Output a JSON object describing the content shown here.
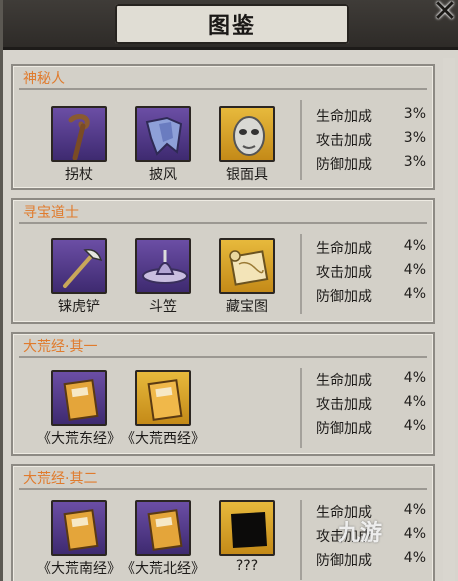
{
  "window": {
    "title": "图鉴",
    "close_label": "✕"
  },
  "sets": [
    {
      "name": "神秘人",
      "items": [
        {
          "label": "拐杖",
          "icon": "cane-icon",
          "rarity": "purple"
        },
        {
          "label": "披风",
          "icon": "cloak-icon",
          "rarity": "purple"
        },
        {
          "label": "银面具",
          "icon": "silver-mask-icon",
          "rarity": "gold"
        }
      ],
      "stats": [
        {
          "name": "生命加成",
          "value": "3%"
        },
        {
          "name": "攻击加成",
          "value": "3%"
        },
        {
          "name": "防御加成",
          "value": "3%"
        }
      ]
    },
    {
      "name": "寻宝道士",
      "items": [
        {
          "label": "铼虎铲",
          "icon": "shovel-icon",
          "rarity": "purple"
        },
        {
          "label": "斗笠",
          "icon": "straw-hat-icon",
          "rarity": "purple"
        },
        {
          "label": "藏宝图",
          "icon": "treasure-map-icon",
          "rarity": "gold"
        }
      ],
      "stats": [
        {
          "name": "生命加成",
          "value": "4%"
        },
        {
          "name": "攻击加成",
          "value": "4%"
        },
        {
          "name": "防御加成",
          "value": "4%"
        }
      ]
    },
    {
      "name": "大荒经·其一",
      "items": [
        {
          "label": "《大荒东经》",
          "icon": "scripture-book-icon",
          "rarity": "purple"
        },
        {
          "label": "《大荒西经》",
          "icon": "scripture-book-icon",
          "rarity": "gold"
        }
      ],
      "stats": [
        {
          "name": "生命加成",
          "value": "4%"
        },
        {
          "name": "攻击加成",
          "value": "4%"
        },
        {
          "name": "防御加成",
          "value": "4%"
        }
      ]
    },
    {
      "name": "大荒经·其二",
      "items": [
        {
          "label": "《大荒南经》",
          "icon": "scripture-book-icon",
          "rarity": "purple"
        },
        {
          "label": "《大荒北经》",
          "icon": "scripture-book-icon",
          "rarity": "purple"
        },
        {
          "label": "???",
          "icon": "unknown-silhouette-icon",
          "rarity": "gold"
        }
      ],
      "stats": [
        {
          "name": "生命加成",
          "value": "4%"
        },
        {
          "name": "攻击加成",
          "value": "4%"
        },
        {
          "name": "防御加成",
          "value": "4%"
        }
      ]
    }
  ],
  "watermark": "九游"
}
